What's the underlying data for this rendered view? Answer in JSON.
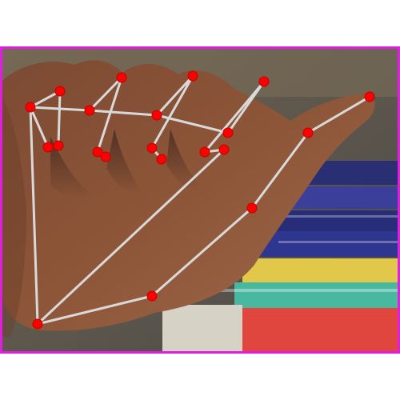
{
  "image": {
    "subject": "hand-pose-keypoints",
    "frame_color": "#e01ee0",
    "line_color": "#d9d9d9",
    "point_color": "#ff0000",
    "point_outline": "#c00000"
  },
  "pose": {
    "keypoint_count": 21,
    "edge_count": 20
  }
}
